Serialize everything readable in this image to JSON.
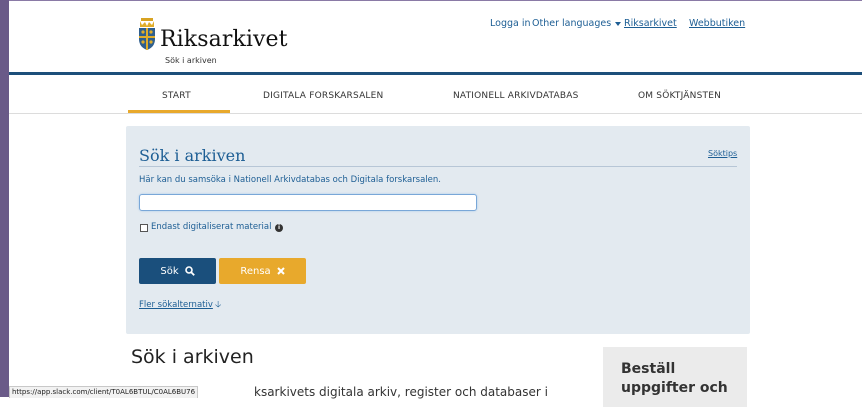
{
  "header": {
    "logo_title": "Riksarkivet",
    "logo_subtitle": "Sök i arkiven",
    "top_links": {
      "login": "Logga in",
      "languages": "Other languages",
      "riksarkivet": "Riksarkivet",
      "webshop": "Webbutiken"
    }
  },
  "nav": {
    "items": [
      "START",
      "DIGITALA FORSKARSALEN",
      "NATIONELL ARKIVDATABAS",
      "OM SÖKTJÄNSTEN"
    ],
    "active": "START"
  },
  "search_panel": {
    "title": "Sök i arkiven",
    "tips_link": "Söktips",
    "description": "Här kan du samsöka i Nationell Arkivdatabas och Digitala forskarsalen.",
    "input_value": "",
    "checkbox_label": "Endast digitaliserat material",
    "checkbox_checked": false,
    "search_button": "Sök",
    "clear_button": "Rensa",
    "more_options": "Fler sökalternativ"
  },
  "content": {
    "heading": "Sök i arkiven",
    "body_text": "ksarkivets digitala arkiv, register och databaser i"
  },
  "side_box": {
    "title": "Beställ uppgifter och"
  },
  "status_bar": {
    "url": "https://app.slack.com/client/T0AL6BTUL/C0AL6BU76"
  },
  "colors": {
    "brand_blue": "#1d4f7a",
    "link_blue": "#1d5e94",
    "accent_orange": "#e8a92c",
    "panel_bg": "#e3eaf0"
  },
  "icons": {
    "logo": "coat-of-arms-icon",
    "search": "magnifier-icon",
    "clear": "x-icon",
    "info": "info-circle-icon",
    "more": "arrow-down-icon",
    "languages": "caret-down-icon"
  }
}
